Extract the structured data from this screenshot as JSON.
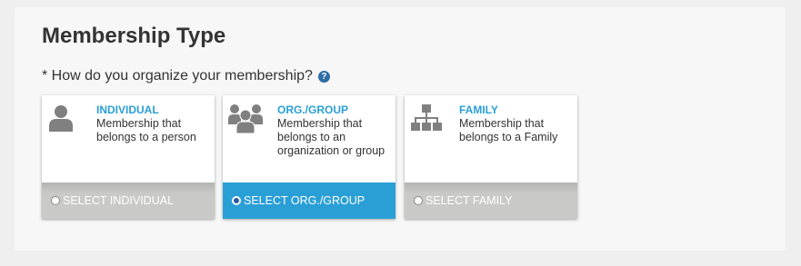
{
  "section": {
    "title": "Membership Type",
    "question": "* How do you organize your membership?",
    "help_icon": "question-circle-icon"
  },
  "colors": {
    "accent": "#2a9fd6",
    "footer_gray": "#c9c9c7",
    "icon_gray": "#808080",
    "help_blue": "#2e6da4"
  },
  "options": [
    {
      "name": "INDIVIDUAL",
      "description": "Membership that belongs to a person",
      "select_label": "SELECT INDIVIDUAL",
      "icon": "person-icon",
      "selected": false
    },
    {
      "name": "ORG./GROUP",
      "description": "Membership that belongs to an organization or group",
      "select_label": "SELECT ORG./GROUP",
      "icon": "group-icon",
      "selected": true
    },
    {
      "name": "FAMILY",
      "description": "Membership that belongs to a Family",
      "select_label": "SELECT FAMILY",
      "icon": "family-tree-icon",
      "selected": false
    }
  ]
}
